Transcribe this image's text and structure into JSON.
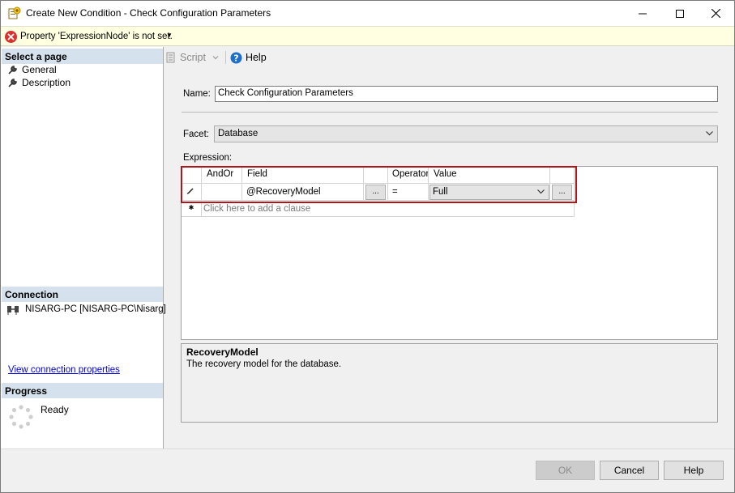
{
  "window": {
    "title": "Create New Condition - Check Configuration Parameters"
  },
  "error_bar": {
    "message": "Property 'ExpressionNode' is not set.",
    "dropdown_glyph": "▼"
  },
  "left_pane": {
    "select_page_header": "Select a page",
    "pages": [
      {
        "label": "General",
        "icon": "wrench-icon"
      },
      {
        "label": "Description",
        "icon": "wrench-icon"
      }
    ],
    "connection_header": "Connection",
    "connection_label": "NISARG-PC [NISARG-PC\\Nisarg]",
    "view_connection_link": "View connection properties",
    "progress_header": "Progress",
    "progress_status": "Ready"
  },
  "toolbar": {
    "script_label": "Script",
    "help_label": "Help"
  },
  "form": {
    "name_label": "Name:",
    "name_value": "Check Configuration Parameters",
    "facet_label": "Facet:",
    "facet_value": "Database",
    "expression_label": "Expression:"
  },
  "expression_grid": {
    "headers": {
      "andor": "AndOr",
      "field": "Field",
      "operator": "Operator",
      "value": "Value"
    },
    "rows": [
      {
        "andor": "",
        "field": "@RecoveryModel",
        "operator": "=",
        "value": "Full"
      }
    ],
    "ellipsis": "...",
    "add_clause_text": "Click here to add a clause"
  },
  "description": {
    "title": "RecoveryModel",
    "text": "The recovery model for the database."
  },
  "buttons": {
    "ok": "OK",
    "cancel": "Cancel",
    "help": "Help"
  },
  "colors": {
    "highlight_border": "#b3141c",
    "error_background": "#ffffe1",
    "section_header": "#d5e1ec"
  }
}
